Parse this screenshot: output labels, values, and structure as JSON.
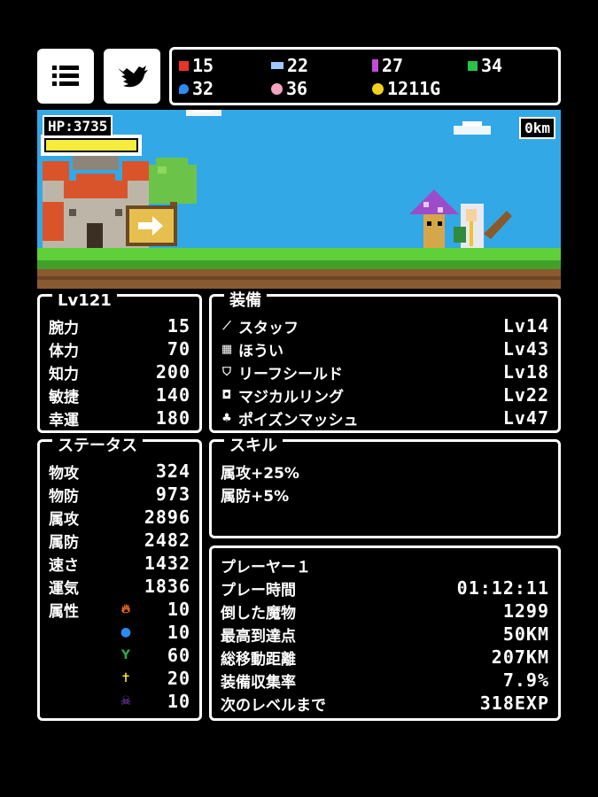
{
  "header": {
    "menu_icon": "list-icon",
    "share_icon": "twitter-bird-icon",
    "resources": [
      {
        "icon": "red-gem",
        "color": "#e8322c",
        "value": "15"
      },
      {
        "icon": "diamond",
        "color": "#9ec8ff",
        "value": "22"
      },
      {
        "icon": "purple-crystal",
        "color": "#c44bd8",
        "value": "27"
      },
      {
        "icon": "green-gem",
        "color": "#27c24a",
        "value": "34"
      },
      {
        "icon": "blue-drop",
        "color": "#2b8cf0",
        "value": "32"
      },
      {
        "icon": "pink-orb",
        "color": "#f4a2c0",
        "value": "36"
      },
      {
        "icon": "gold-coin",
        "color": "#f2d21e",
        "value": "1211G"
      }
    ]
  },
  "scene": {
    "hp_label": "HP:3735",
    "distance": "0km",
    "hp_fill": 1.0
  },
  "level_panel": {
    "title": "Lv121",
    "stats": [
      {
        "label": "腕力",
        "value": "15"
      },
      {
        "label": "体力",
        "value": "70"
      },
      {
        "label": "知力",
        "value": "200"
      },
      {
        "label": "敏捷",
        "value": "140"
      },
      {
        "label": "幸運",
        "value": "180"
      }
    ]
  },
  "equipment_panel": {
    "title": "装備",
    "items": [
      {
        "icon": "staff-icon",
        "name": "スタッフ",
        "level": "Lv14"
      },
      {
        "icon": "robe-icon",
        "name": "ほうい",
        "level": "Lv43"
      },
      {
        "icon": "shield-icon",
        "name": "リーフシールド",
        "level": "Lv18"
      },
      {
        "icon": "ring-icon",
        "name": "マジカルリング",
        "level": "Lv22"
      },
      {
        "icon": "mushroom-icon",
        "name": "ポイズンマッシュ",
        "level": "Lv47"
      }
    ]
  },
  "status_panel": {
    "title": "ステータス",
    "stats": [
      {
        "label": "物攻",
        "value": "324"
      },
      {
        "label": "物防",
        "value": "973"
      },
      {
        "label": "属攻",
        "value": "2896"
      },
      {
        "label": "属防",
        "value": "2482"
      },
      {
        "label": "速さ",
        "value": "1432"
      },
      {
        "label": "運気",
        "value": "1836"
      }
    ],
    "attribute_label": "属性",
    "attributes": [
      {
        "icon": "fire-icon",
        "color": "#f06a1e",
        "value": "10"
      },
      {
        "icon": "water-icon",
        "color": "#2b8cf0",
        "value": "10"
      },
      {
        "icon": "plant-icon",
        "color": "#2ca84a",
        "value": "60"
      },
      {
        "icon": "holy-cross-icon",
        "color": "#f2e21e",
        "value": "20"
      },
      {
        "icon": "dark-skull-icon",
        "color": "#8a46d8",
        "value": "10"
      }
    ]
  },
  "skill_panel": {
    "title": "スキル",
    "skills": [
      "属攻+25%",
      "属防+5%"
    ]
  },
  "player_panel": {
    "title": "プレーヤー１",
    "rows": [
      {
        "label": "プレー時間",
        "value": "01:12:11"
      },
      {
        "label": "倒した魔物",
        "value": "1299"
      },
      {
        "label": "最高到達点",
        "value": "50KM"
      },
      {
        "label": "総移動距離",
        "value": "207KM"
      },
      {
        "label": "装備収集率",
        "value": "7.9%"
      },
      {
        "label": "次のレベルまで",
        "value": "318EXP"
      }
    ]
  }
}
